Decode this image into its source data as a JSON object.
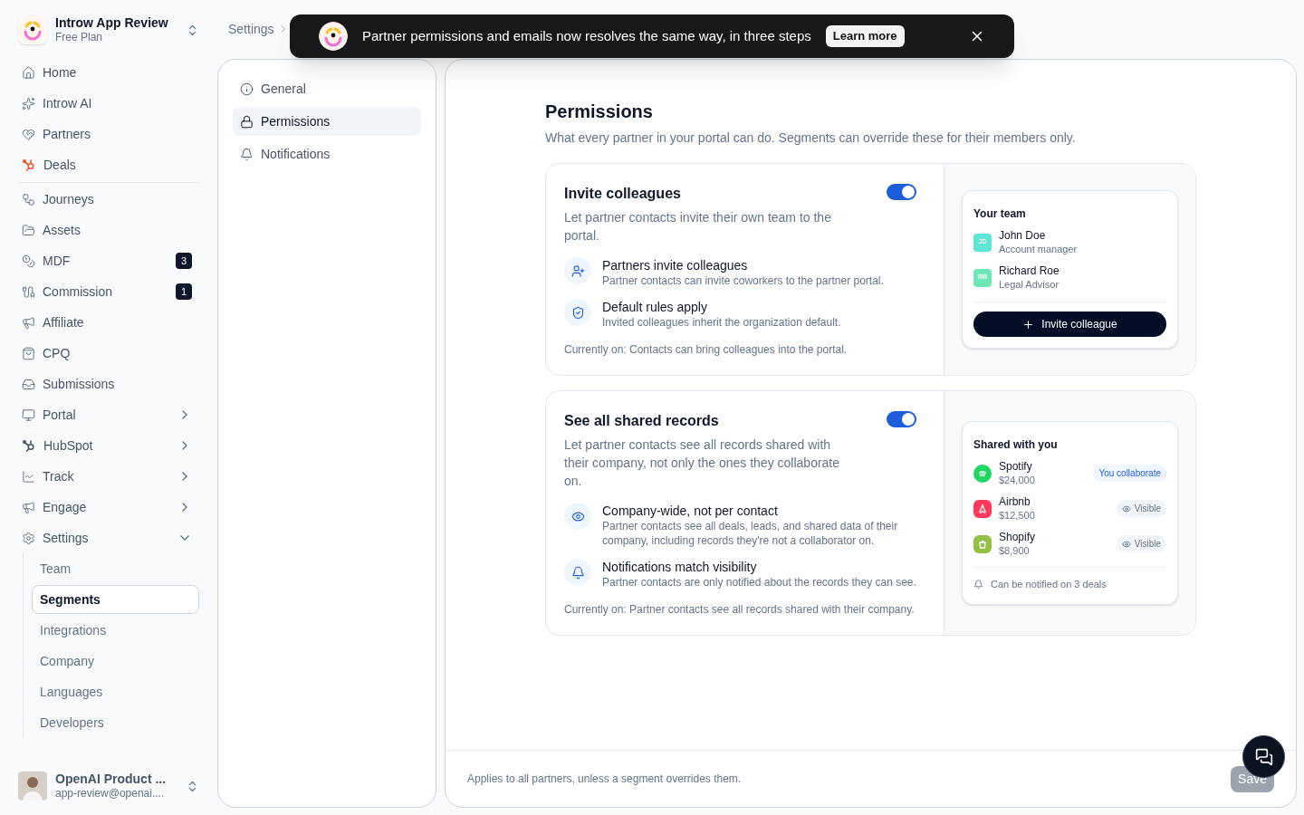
{
  "workspace": {
    "name": "Introw App Review",
    "plan": "Free Plan"
  },
  "sidebar": {
    "sections": [
      [
        {
          "label": "Home",
          "selected": false
        },
        {
          "label": "Introw AI",
          "selected": false
        },
        {
          "label": "Partners",
          "selected": false
        },
        {
          "label": "Deals",
          "selected": false
        }
      ],
      [
        {
          "label": "Journeys",
          "selected": false
        },
        {
          "label": "Assets",
          "selected": false
        },
        {
          "label": "MDF",
          "badge": "3",
          "selected": false
        },
        {
          "label": "Commission",
          "badge": "1",
          "selected": false
        },
        {
          "label": "Affiliate",
          "selected": false
        },
        {
          "label": "CPQ",
          "selected": false
        },
        {
          "label": "Submissions",
          "selected": false
        },
        {
          "label": "Portal",
          "expanded": false,
          "selected": false
        },
        {
          "label": "HubSpot",
          "expanded": false,
          "selected": false
        },
        {
          "label": "Track",
          "expanded": false,
          "selected": false
        },
        {
          "label": "Engage",
          "expanded": false,
          "selected": false
        },
        {
          "label": "Settings",
          "expanded": true,
          "selected": false,
          "children": [
            {
              "label": "Team",
              "selected": false
            },
            {
              "label": "Segments",
              "selected": true
            },
            {
              "label": "Integrations",
              "selected": false
            },
            {
              "label": "Company",
              "selected": false
            },
            {
              "label": "Languages",
              "selected": false
            },
            {
              "label": "Developers",
              "selected": false
            }
          ]
        }
      ]
    ]
  },
  "user": {
    "name": "OpenAI Product ...",
    "email": "app-review@openai...."
  },
  "breadcrumb": [
    "Settings"
  ],
  "banner": {
    "text": "Partner permissions and emails now resolves the same way, in three steps",
    "button": "Learn more"
  },
  "settings_nav": [
    {
      "label": "General",
      "selected": false
    },
    {
      "label": "Permissions",
      "selected": true
    },
    {
      "label": "Notifications",
      "selected": false
    }
  ],
  "page": {
    "title": "Permissions",
    "description": "What every partner in your portal can do. Segments can override these for their members only."
  },
  "cards": [
    {
      "title": "Invite colleagues",
      "description": "Let partner contacts invite their own team to the portal.",
      "on": true,
      "features": [
        {
          "title": "Partners invite colleagues",
          "text": "Partner contacts can invite coworkers to the partner portal."
        },
        {
          "title": "Default rules apply",
          "text": "Invited colleagues inherit the organization default."
        }
      ],
      "status": "Currently on: Contacts can bring colleagues into the portal.",
      "preview": {
        "kind": "team",
        "title": "Your team",
        "members": [
          {
            "initials": "JD",
            "name": "John Doe",
            "role": "Account manager",
            "color": "#5fe6d3"
          },
          {
            "initials": "RR",
            "name": "Richard Roe",
            "role": "Legal Advisor",
            "color": "#6ee7b7"
          }
        ],
        "button": "Invite colleague"
      }
    },
    {
      "title": "See all shared records",
      "description": "Let partner contacts see all records shared with their company, not only the ones they collaborate on.",
      "on": true,
      "features": [
        {
          "title": "Company-wide, not per contact",
          "text": "Partner contacts see all deals, leads, and shared data of their company, including records they're not a collaborator on."
        },
        {
          "title": "Notifications match visibility",
          "text": "Partner contacts are only notified about the records they can see."
        }
      ],
      "status": "Currently on: Partner contacts see all records shared with their company.",
      "preview": {
        "kind": "shared",
        "title": "Shared with you",
        "records": [
          {
            "name": "Spotify",
            "amount": "$24,000",
            "badge": "You collaborate",
            "kind": "collaborate",
            "color": "#1ed760"
          },
          {
            "name": "Airbnb",
            "amount": "$12,500",
            "badge": "Visible",
            "kind": "visible",
            "color": "#ff385c"
          },
          {
            "name": "Shopify",
            "amount": "$8,900",
            "badge": "Visible",
            "kind": "visible",
            "color": "#95bf47"
          }
        ],
        "footer": "Can be notified on 3 deals"
      }
    }
  ],
  "footer": {
    "text": "Applies to all partners, unless a segment overrides them.",
    "save": "Save",
    "save_disabled": true
  }
}
